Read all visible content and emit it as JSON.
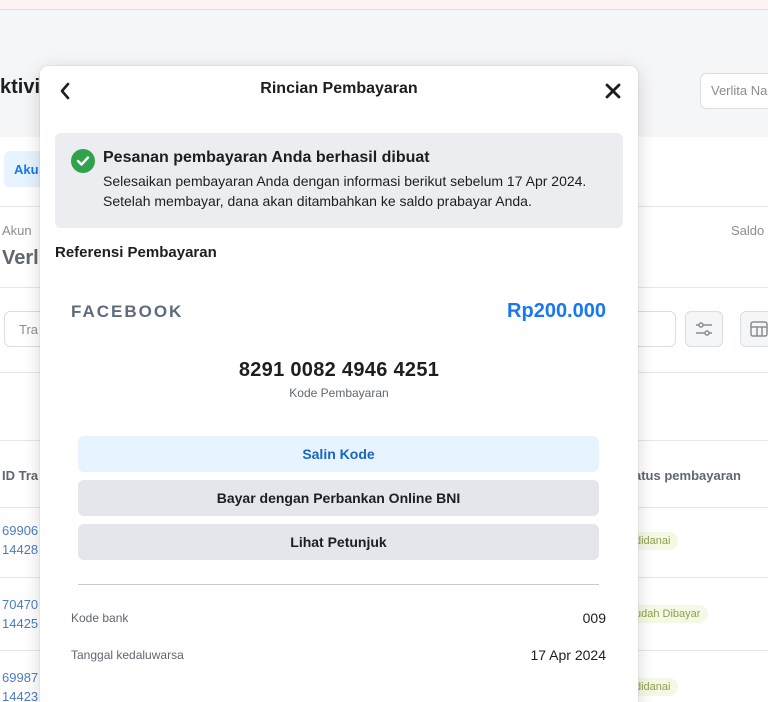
{
  "background": {
    "page_title_fragment": "ktivi",
    "account_select_placeholder": "Verlita Na",
    "tab_fragment": "Aku",
    "account_label_fragment": "Akun",
    "balance_label_fragment": "Saldo",
    "account_name_fragment": "Verl",
    "search_placeholder_fragment": "Tra",
    "table": {
      "col_id_fragment": "ID Tra",
      "col_status_fragment": "atus pembayaran",
      "rows": [
        {
          "id_line1": "69906",
          "id_line2": "14428",
          "status": "didanai"
        },
        {
          "id_line1": "70470",
          "id_line2": "14425",
          "status": "udah Dibayar"
        },
        {
          "id_line1": "69987",
          "id_line2": "14423",
          "status": "didanai"
        }
      ]
    },
    "icons": [
      "filter-icon",
      "table-columns-icon"
    ]
  },
  "modal": {
    "title": "Rincian Pembayaran",
    "back_icon": "chevron-left-icon",
    "close_icon": "close-icon",
    "notice": {
      "icon": "check-circle-icon",
      "title": "Pesanan pembayaran Anda berhasil dibuat",
      "body": "Selesaikan pembayaran Anda dengan informasi berikut sebelum 17 Apr 2024. Setelah membayar, dana akan ditambahkan ke saldo prabayar Anda."
    },
    "reference_heading": "Referensi Pembayaran",
    "merchant": "FACEBOOK",
    "amount": "Rp200.000",
    "payment_code": "8291 0082 4946 4251",
    "payment_code_label": "Kode Pembayaran",
    "buttons": {
      "copy_code": "Salin Kode",
      "pay_bank": "Bayar dengan Perbankan Online BNI",
      "view_guide": "Lihat Petunjuk"
    },
    "details": [
      {
        "label": "Kode bank",
        "value": "009"
      },
      {
        "label": "Tanggal kedaluwarsa",
        "value": "17 Apr 2024"
      }
    ]
  },
  "colors": {
    "accent": "#1877f2",
    "success": "#31a24c",
    "notice_bg": "#ebedf0",
    "copy_button_bg": "#e7f3ff",
    "secondary_button_bg": "#e4e6eb"
  }
}
